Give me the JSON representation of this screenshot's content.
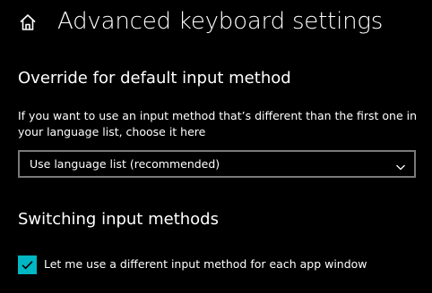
{
  "header": {
    "title": "Advanced keyboard settings",
    "home_icon": "home-icon"
  },
  "override_section": {
    "heading": "Override for default input method",
    "description": "If you want to use an input method that’s different than the first one in your language list, choose it here",
    "dropdown": {
      "selected": "Use language list (recommended)",
      "icon": "chevron-down-icon"
    }
  },
  "switching_section": {
    "heading": "Switching input methods",
    "checkbox": {
      "label": "Let me use a different input method for each app window",
      "checked": true
    }
  },
  "colors": {
    "background": "#000000",
    "text": "#ffffff",
    "accent": "#00b7c3",
    "dropdown_border": "#7a7a7a"
  }
}
